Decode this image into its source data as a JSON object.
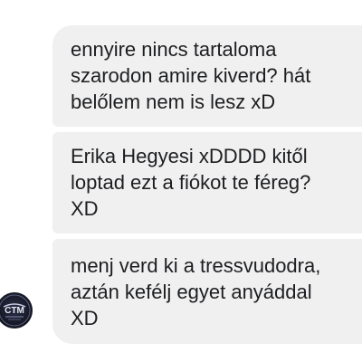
{
  "messages": [
    {
      "lines": [
        "ennyire nincs tartaloma",
        "szarodon amire kiverd? hát",
        "belőlem nem is lesz xD"
      ]
    },
    {
      "lines": [
        "Erika Hegyesi xDDDD kitől",
        "loptad ezt a fiókot te féreg?",
        "XD"
      ]
    },
    {
      "lines": [
        "menj verd ki a tressvudodra,",
        "aztán kefélj egyet anyáddal",
        "XD"
      ]
    }
  ],
  "avatar": {
    "icon": "profile-avatar-icon",
    "logo_text": "CTM"
  },
  "colors": {
    "bubble": "#f1f0f0",
    "text": "#1c1e21",
    "background": "#ffffff"
  }
}
